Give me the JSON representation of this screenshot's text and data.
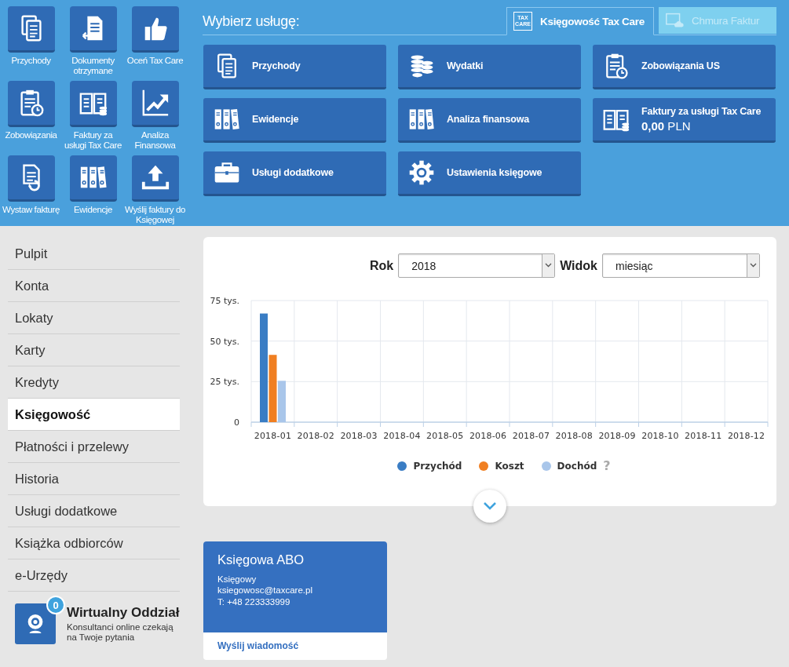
{
  "quick_tiles": [
    {
      "label": "Przychody"
    },
    {
      "label": "Dokumenty otrzymane"
    },
    {
      "label": "Oceń Tax Care"
    },
    {
      "label": "Zobowiązania"
    },
    {
      "label": "Faktury za usługi Tax Care"
    },
    {
      "label": "Analiza Finansowa"
    },
    {
      "label": "Wystaw fakturę"
    },
    {
      "label": "Ewidencje"
    },
    {
      "label": "Wyślij faktury do Księgowej"
    }
  ],
  "services": {
    "title": "Wybierz usługę:",
    "tabs": [
      {
        "logo": "TAX CARE",
        "label": "Księgowość Tax Care",
        "selected": true
      },
      {
        "label": "Chmura Faktur",
        "selected": false
      }
    ],
    "items": [
      {
        "label": "Przychody"
      },
      {
        "label": "Wydatki"
      },
      {
        "label": "Zobowiązania US"
      },
      {
        "label": "Ewidencje"
      },
      {
        "label": "Analiza finansowa"
      },
      {
        "label": "Faktury za usługi Tax Care",
        "amount": "**0,00** PLN"
      },
      {
        "label": "Usługi dodatkowe"
      },
      {
        "label": "Ustawienia księgowe"
      }
    ]
  },
  "sidebar": {
    "items": [
      {
        "label": "Pulpit",
        "selected": false
      },
      {
        "label": "Konta",
        "selected": false
      },
      {
        "label": "Lokaty",
        "selected": false
      },
      {
        "label": "Karty",
        "selected": false
      },
      {
        "label": "Kredyty",
        "selected": false
      },
      {
        "label": "Księgowość",
        "selected": true
      },
      {
        "label": "Płatności i przelewy",
        "selected": false
      },
      {
        "label": "Historia",
        "selected": false
      },
      {
        "label": "Usługi dodatkowe",
        "selected": false
      },
      {
        "label": "Książka odbiorców",
        "selected": false
      },
      {
        "label": "e-Urzędy",
        "selected": false
      }
    ],
    "virtual_branch": {
      "badge": "0",
      "title": "Wirtualny Oddział",
      "subtitle": "Konsultanci online czekają na Twoje pytania"
    }
  },
  "chart_panel": {
    "filters": [
      {
        "label": "Rok",
        "value": "2018"
      },
      {
        "label": "Widok",
        "value": "miesiąc"
      }
    ],
    "chart_data": {
      "type": "bar",
      "categories": [
        "2018-01",
        "2018-02",
        "2018-03",
        "2018-04",
        "2018-05",
        "2018-06",
        "2018-07",
        "2018-08",
        "2018-09",
        "2018-10",
        "2018-11",
        "2018-12"
      ],
      "series": [
        {
          "name": "Przychód",
          "color": "#3a7dc4",
          "values": [
            67,
            null,
            null,
            null,
            null,
            null,
            null,
            null,
            null,
            null,
            null,
            null
          ]
        },
        {
          "name": "Koszt",
          "color": "#f07f22",
          "values": [
            41.5,
            null,
            null,
            null,
            null,
            null,
            null,
            null,
            null,
            null,
            null,
            null
          ]
        },
        {
          "name": "Dochód",
          "color": "#a9c6ea",
          "values": [
            25.5,
            null,
            null,
            null,
            null,
            null,
            null,
            null,
            null,
            null,
            null,
            null
          ]
        }
      ],
      "ylim": [
        0,
        75
      ],
      "yticks": [
        {
          "value": 0,
          "label": "0"
        },
        {
          "value": 25,
          "label": "25 tys."
        },
        {
          "value": 50,
          "label": "50 tys."
        },
        {
          "value": 75,
          "label": "75 tys."
        }
      ]
    },
    "help": "?"
  },
  "accountant": {
    "name": "Księgowa ABO",
    "role": "Księgowy",
    "email": "ksiegowosc@taxcare.pl",
    "phone": "T: +48 223333999",
    "action": "Wyślij wiadomość"
  }
}
